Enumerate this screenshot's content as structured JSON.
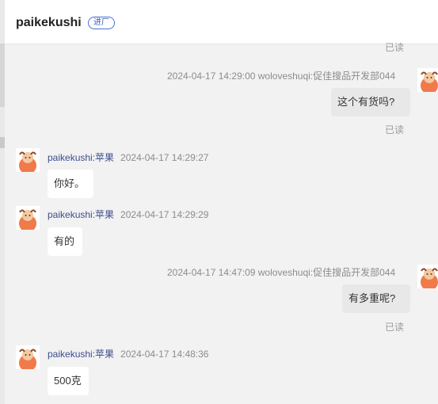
{
  "header": {
    "title": "paikekushi",
    "badge": "进厂"
  },
  "read_label": "已读",
  "messages": [
    {
      "side": "right",
      "meta": "2024-04-17 14:29:00   woloveshuqi:促佳搜品开发部044",
      "text": "这个有货吗?"
    },
    {
      "side": "left",
      "name": "paikekushi:苹果",
      "time": "2024-04-17 14:29:27",
      "text": "你好。"
    },
    {
      "side": "left",
      "name": "paikekushi:苹果",
      "time": "2024-04-17 14:29:29",
      "text": "有的"
    },
    {
      "side": "right",
      "meta": "2024-04-17 14:47:09   woloveshuqi:促佳搜品开发部044",
      "text": "有多重呢?"
    },
    {
      "side": "left",
      "name": "paikekushi:苹果",
      "time": "2024-04-17 14:48:36",
      "text": "500克"
    }
  ],
  "colors": {
    "avatar": "#f07a4a",
    "link": "#3c4d8e",
    "badge": "#3b5bc6"
  }
}
